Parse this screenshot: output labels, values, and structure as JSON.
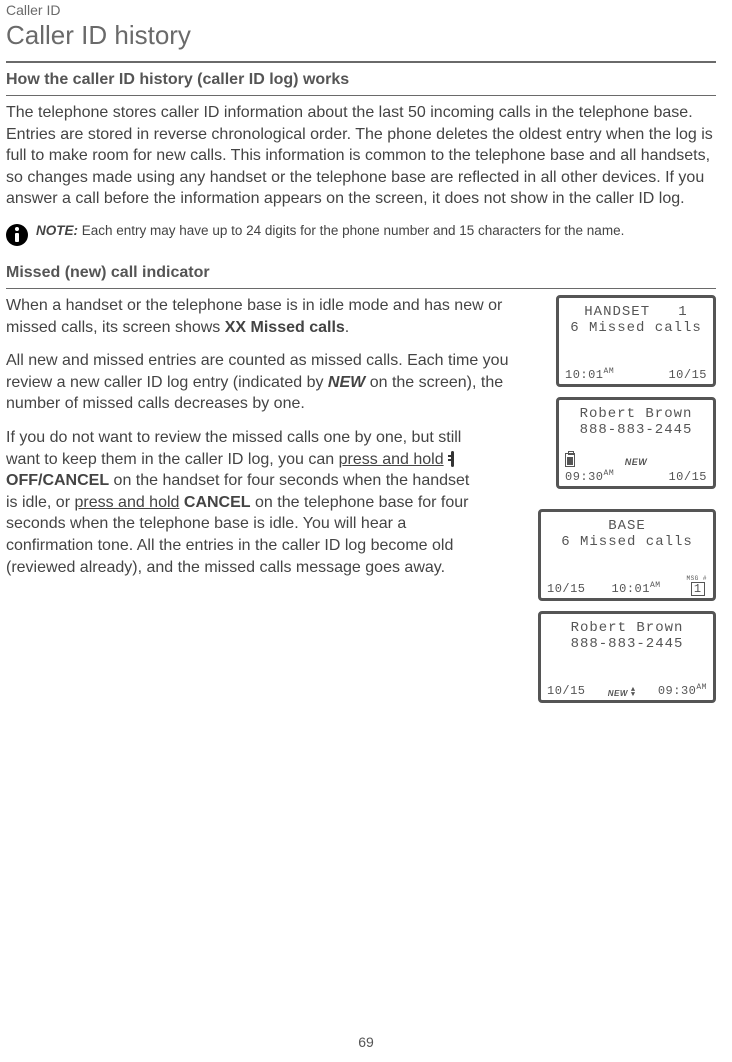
{
  "eyebrow": "Caller ID",
  "title": "Caller ID history",
  "section1": {
    "heading": "How the caller ID history (caller ID log) works",
    "body": "The telephone stores caller ID information about the last 50 incoming calls in the telephone base. Entries are stored in reverse chronological order. The phone deletes the oldest entry when the log is full to make room for new calls. This information is common to the telephone base and all handsets, so changes made using any handset or the telephone base are reflected in all other devices. If you answer a call before the information appears on the screen, it does not show in the caller ID log."
  },
  "note": {
    "label": "NOTE:",
    "text": " Each entry may have up to 24 digits for the phone number and 15 characters for the name."
  },
  "section2": {
    "heading": "Missed (new) call indicator",
    "p1_a": "When a handset or the telephone base is in idle mode and has new or missed calls, its screen shows ",
    "p1_bold": "XX Missed calls",
    "p1_b": ".",
    "p2_a": "All new and missed entries are counted as missed calls. Each time you review a new caller ID log entry (indicated by ",
    "p2_bolditalic": "NEW",
    "p2_b": " on the screen), the number of missed calls decreases by one.",
    "p3_a": "If you do not want to review the missed calls one by one, but still want to keep them in the caller ID log, you can ",
    "p3_u1": "press and hold",
    "p3_b": " ",
    "p3_bold1": "OFF/CANCEL",
    "p3_c": " on the handset for four seconds when the handset is idle, or ",
    "p3_u2": "press and hold",
    "p3_d": " ",
    "p3_bold2": "CANCEL",
    "p3_e": " on the telephone base for four seconds when the telephone base is idle. You will hear a confirmation tone. All the entries in the caller ID log become old (reviewed already), and the missed calls message goes away."
  },
  "screens": {
    "handset_idle": {
      "line1": "HANDSET   1",
      "line2": "6 Missed calls",
      "time": "10:01",
      "ampm": "AM",
      "date": "10/15"
    },
    "handset_entry": {
      "name": "Robert Brown",
      "number": "888-883-2445",
      "new": "NEW",
      "time": "09:30",
      "ampm": "AM",
      "date": "10/15"
    },
    "base_idle": {
      "line1": "BASE",
      "line2": "6 Missed calls",
      "date": "10/15",
      "time": "10:01",
      "ampm": "AM",
      "msg_label": "MSG #",
      "msg_count": "1"
    },
    "base_entry": {
      "name": "Robert Brown",
      "number": "888-883-2445",
      "date": "10/15",
      "new": "NEW",
      "time": "09:30",
      "ampm": "AM"
    }
  },
  "page_number": "69"
}
